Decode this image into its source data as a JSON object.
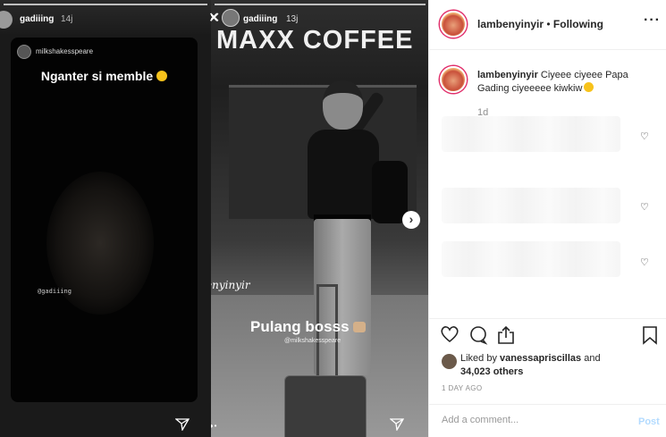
{
  "story_left": {
    "username": "gadiiing",
    "time": "14j",
    "inner_username": "milkshakesspeare",
    "caption": "Nganter si memble",
    "tag": "@gadiiing",
    "send_icon": "send-icon"
  },
  "story_right": {
    "username": "gadiiing",
    "time": "13j",
    "sign": "MAXX COFFEE",
    "watermark": "@lambenyinyir",
    "caption": "Pulang bosss",
    "caption_tag": "@milkshakesspeare",
    "next_icon": "chevron-right-icon",
    "close_icon": "close-icon"
  },
  "header": {
    "username": "lambenyinyir",
    "separator": " • ",
    "follow_status": "Following",
    "more_label": "···"
  },
  "comment": {
    "username": "lambenyinyir",
    "text": " Ciyeee ciyeee Papa Gading ciyeeeee kiwkiw",
    "age": "1d"
  },
  "actions": {
    "like_icon": "heart-icon",
    "comment_icon": "comment-icon",
    "share_icon": "share-icon",
    "save_icon": "bookmark-icon"
  },
  "likes": {
    "prefix": "Liked by ",
    "user": "vanessapriscillas",
    "middle": " and ",
    "count": "34,023 others"
  },
  "posted": "1 DAY AGO",
  "add_comment": {
    "placeholder": "Add a comment...",
    "post_label": "Post"
  }
}
